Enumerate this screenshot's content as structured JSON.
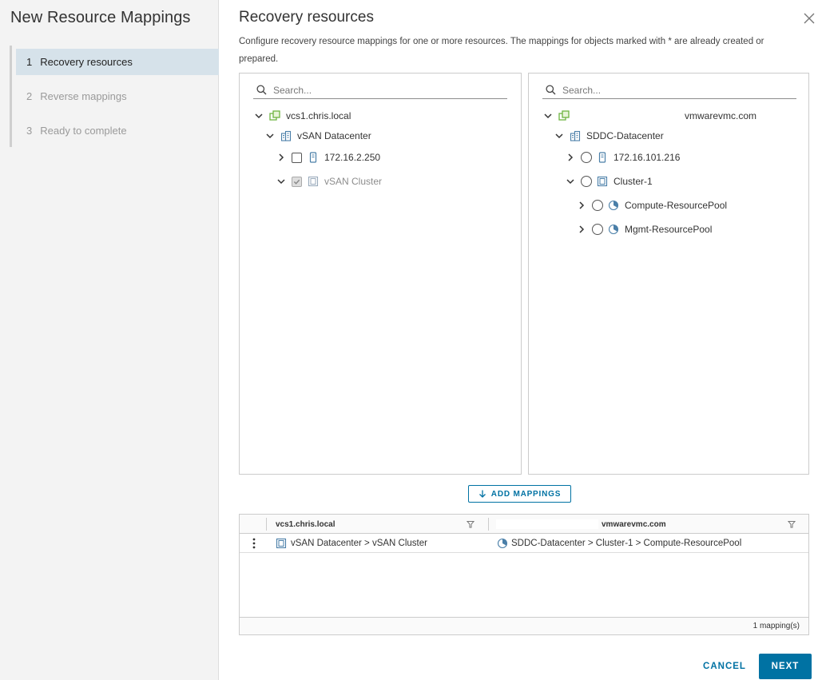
{
  "wizard": {
    "title": "New Resource Mappings",
    "steps": [
      {
        "num": "1",
        "label": "Recovery resources",
        "active": true
      },
      {
        "num": "2",
        "label": "Reverse mappings",
        "active": false
      },
      {
        "num": "3",
        "label": "Ready to complete",
        "active": false
      }
    ]
  },
  "main": {
    "title": "Recovery resources",
    "description": "Configure recovery resource mappings for one or more resources. The mappings for objects marked with * are already created or prepared."
  },
  "left_tree": {
    "search_placeholder": "Search...",
    "nodes": [
      {
        "label": "vcs1.chris.local",
        "icon": "vcenter-icon"
      },
      {
        "label": "vSAN Datacenter",
        "icon": "datacenter-icon"
      },
      {
        "label": "172.16.2.250",
        "icon": "host-icon"
      },
      {
        "label": "vSAN Cluster",
        "icon": "cluster-icon"
      }
    ]
  },
  "right_tree": {
    "search_placeholder": "Search...",
    "nodes": [
      {
        "label": "vmwarevmc.com",
        "icon": "vcenter-icon"
      },
      {
        "label": "SDDC-Datacenter",
        "icon": "datacenter-icon"
      },
      {
        "label": "172.16.101.216",
        "icon": "host-icon"
      },
      {
        "label": "Cluster-1",
        "icon": "cluster-icon"
      },
      {
        "label": "Compute-ResourcePool",
        "icon": "resource-pool-icon"
      },
      {
        "label": "Mgmt-ResourcePool",
        "icon": "resource-pool-icon"
      }
    ]
  },
  "add_button": {
    "label": "ADD MAPPINGS"
  },
  "grid": {
    "columns": [
      "vcs1.chris.local",
      "vmwarevmc.com"
    ],
    "rows": [
      {
        "source": "vSAN Datacenter > vSAN Cluster",
        "target": "SDDC-Datacenter > Cluster-1 > Compute-ResourcePool"
      }
    ],
    "footer": "1 mapping(s)"
  },
  "footer": {
    "cancel": "CANCEL",
    "next": "NEXT"
  },
  "colors": {
    "accent": "#0072a3",
    "vcenter_icon": "#6db33f"
  }
}
